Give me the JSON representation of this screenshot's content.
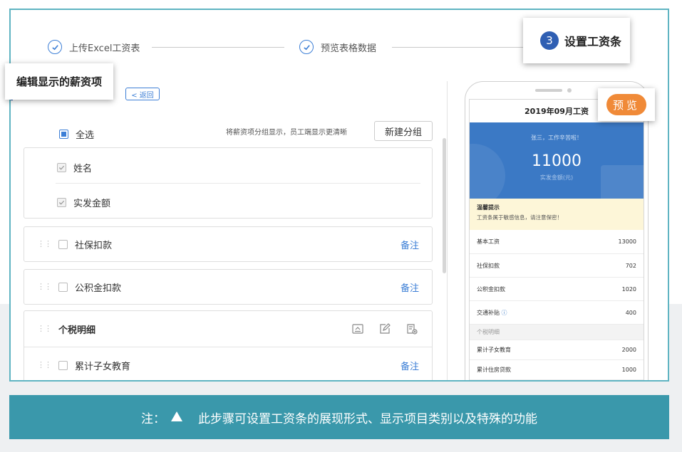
{
  "steps": [
    {
      "label": "上传Excel工资表",
      "state": "done"
    },
    {
      "label": "预览表格数据",
      "state": "done"
    },
    {
      "number": "3",
      "label": "设置工资条",
      "state": "active"
    }
  ],
  "editor": {
    "title": "编辑显示的薪资项",
    "back_label": "< 返回",
    "select_all": "全选",
    "hint": "将薪资项分组显示，员工端显示更清晰",
    "new_group": "新建分组",
    "fixed_items": [
      "姓名",
      "实发金额"
    ],
    "items": [
      {
        "label": "社保扣款",
        "note": "备注"
      },
      {
        "label": "公积金扣款",
        "note": "备注"
      }
    ],
    "group": {
      "label": "个税明细",
      "icons": [
        "collapse-icon",
        "edit-icon",
        "delete-icon"
      ]
    },
    "group_items": [
      {
        "label": "累计子女教育",
        "note": "备注"
      }
    ]
  },
  "preview": {
    "button": "预览",
    "title": "2019年09月工资",
    "greeting": "张三，工作辛苦啦！",
    "amount": "11000",
    "amount_label": "实发金额(元)",
    "tip_title": "温馨提示",
    "tip_text": "工资条属于敏感信息，请注意保密！",
    "rows": [
      {
        "label": "基本工资",
        "value": "13000"
      },
      {
        "label": "社保扣款",
        "value": "702"
      },
      {
        "label": "公积金扣款",
        "value": "1020"
      },
      {
        "label": "交通补贴",
        "value": "400"
      }
    ],
    "group_label": "个税明细",
    "group_rows": [
      {
        "label": "累计子女教育",
        "value": "2000"
      },
      {
        "label": "累计住房贷款",
        "value": "1000"
      }
    ]
  },
  "caption": {
    "prefix": "注：",
    "text": "此步骤可设置工资条的展现形式、显示项目类别以及特殊的功能"
  },
  "colors": {
    "accent": "#3d7fd6",
    "banner": "#3a98ab",
    "preview_button": "#f08a38",
    "phone_header": "#3b79c5",
    "frame": "#5fb4c2"
  }
}
